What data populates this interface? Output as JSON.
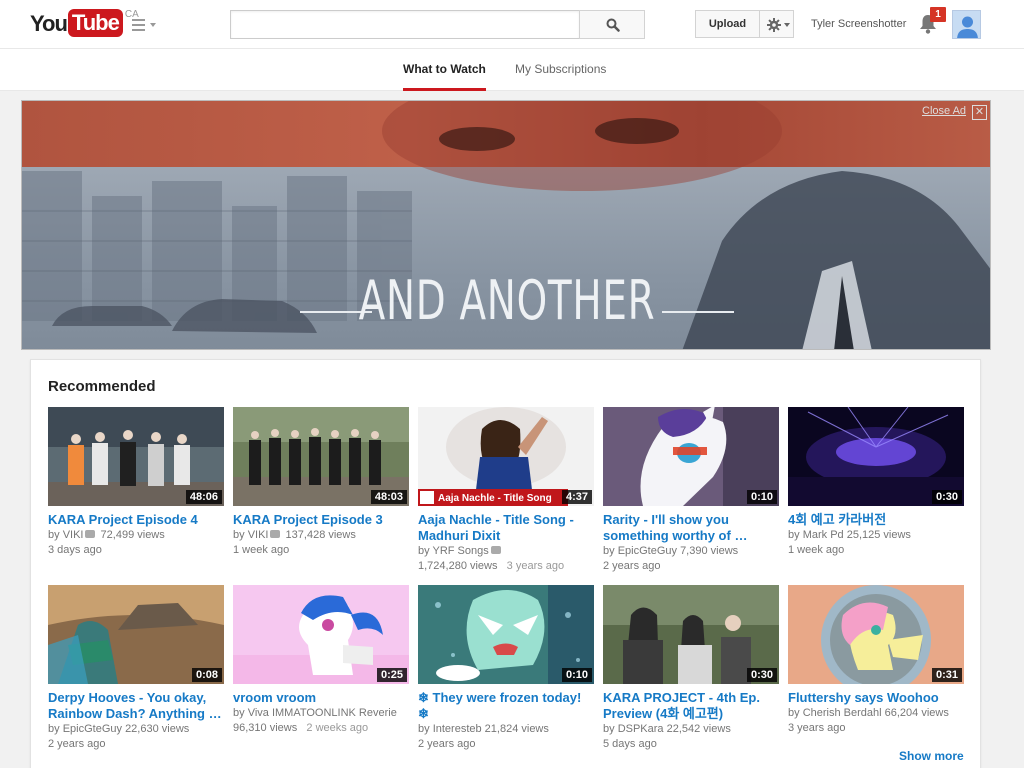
{
  "header": {
    "logo_you": "You",
    "logo_tube": "Tube",
    "region": "CA",
    "search": {
      "value": "",
      "placeholder": ""
    },
    "upload_label": "Upload",
    "username": "Tyler Screenshotter",
    "notification_count": "1"
  },
  "tabs": [
    {
      "label": "What to Watch",
      "active": true
    },
    {
      "label": "My Subscriptions",
      "active": false
    }
  ],
  "ad": {
    "title": "AND ANOTHER",
    "close_label": "Close Ad",
    "close_x": "✕"
  },
  "recommended": {
    "title": "Recommended",
    "show_more": "Show more",
    "videos": [
      {
        "title": "KARA Project Episode 4",
        "channel": "VIKI",
        "verified": true,
        "views": "72,499 views",
        "age": "3 days ago",
        "duration": "48:06"
      },
      {
        "title": "KARA Project Episode 3",
        "channel": "VIKI",
        "verified": true,
        "views": "137,428 views",
        "age": "1 week ago",
        "duration": "48:03"
      },
      {
        "title": "Aaja Nachle - Title Song - Madhuri Dixit",
        "channel": "YRF Songs",
        "verified": true,
        "views": "1,724,280 views",
        "age": "3 years ago",
        "duration": "4:37",
        "thumb_caption": "Aaja Nachle - Title Song"
      },
      {
        "title": "Rarity - I'll show you something worthy of …",
        "channel": "EpicGteGuy",
        "verified": false,
        "views": "7,390 views",
        "age": "2 years ago",
        "duration": "0:10"
      },
      {
        "title": "4회 예고 카라버전",
        "channel": "Mark Pd",
        "verified": false,
        "views": "25,125 views",
        "age": "1 week ago",
        "duration": "0:30"
      },
      {
        "title": "Derpy Hooves - You okay, Rainbow Dash? Anything …",
        "channel": "EpicGteGuy",
        "verified": false,
        "views": "22,630 views",
        "age": "2 years ago",
        "duration": "0:08"
      },
      {
        "title": "vroom vroom",
        "channel": "Viva IMMATOONLINK Reverie",
        "verified": false,
        "views": "96,310 views",
        "age": "2 weeks ago",
        "duration": "0:25"
      },
      {
        "title": "❄ They were frozen today! ❄",
        "channel": "Interesteb",
        "verified": false,
        "views": "21,824 views",
        "age": "2 years ago",
        "duration": "0:10"
      },
      {
        "title": "KARA PROJECT - 4th Ep. Preview (4화 예고편)",
        "channel": "DSPKara",
        "verified": false,
        "views": "22,542 views",
        "age": "5 days ago",
        "duration": "0:30"
      },
      {
        "title": "Fluttershy says Woohoo",
        "channel": "Cherish Berdahl",
        "verified": false,
        "views": "66,204 views",
        "age": "3 years ago",
        "duration": "0:31"
      }
    ]
  }
}
